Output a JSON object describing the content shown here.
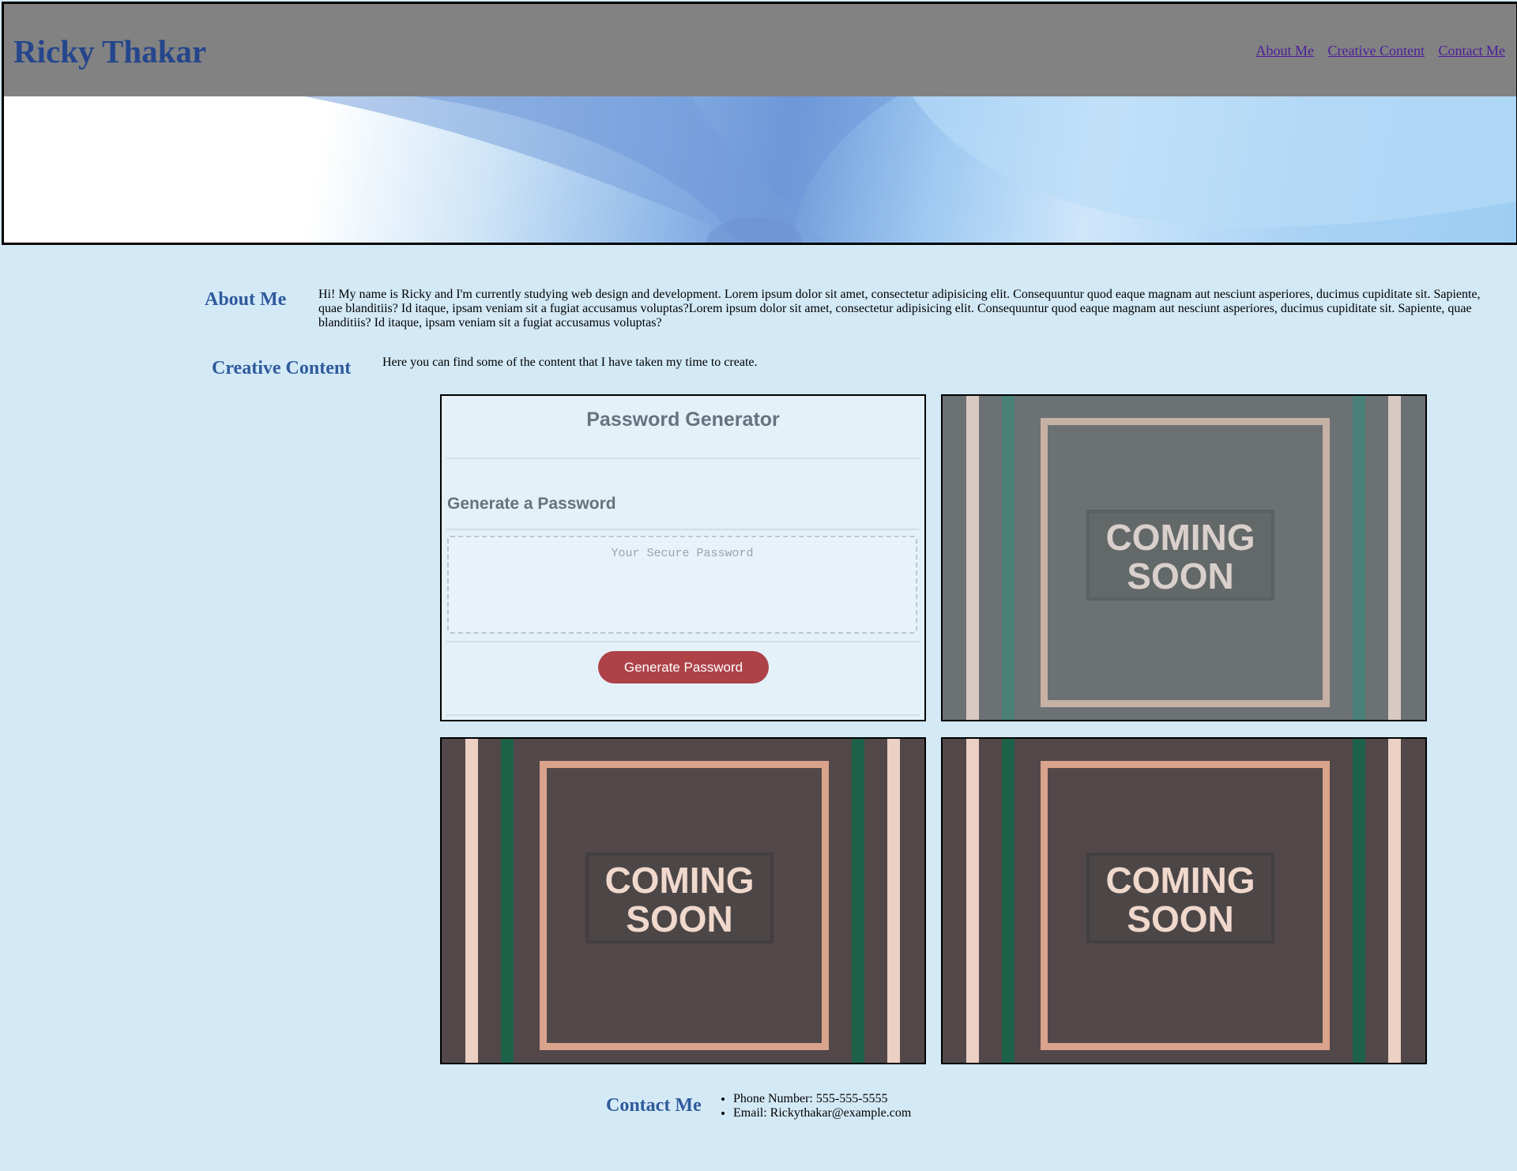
{
  "header": {
    "title": "Ricky Thakar",
    "nav": [
      "About Me",
      "Creative Content",
      "Contact Me"
    ]
  },
  "about": {
    "heading": "About Me",
    "text": "Hi! My name is Ricky and I'm currently studying web design and development. Lorem ipsum dolor sit amet, consectetur adipisicing elit. Consequuntur quod eaque magnam aut nesciunt asperiores, ducimus cupiditate sit. Sapiente, quae blanditiis? Id itaque, ipsam veniam sit a fugiat accusamus voluptas?Lorem ipsum dolor sit amet, consectetur adipisicing elit. Consequuntur quod eaque magnam aut nesciunt asperiores, ducimus cupiditate sit. Sapiente, quae blanditiis? Id itaque, ipsam veniam sit a fugiat accusamus voluptas?"
  },
  "creative": {
    "heading": "Creative Content",
    "intro": "Here you can find some of the content that I have taken my time to create.",
    "password_card": {
      "title": "Password Generator",
      "subtitle": "Generate a Password",
      "placeholder": "Your Secure Password",
      "button": "Generate Password"
    },
    "coming_soon": [
      "COMING",
      "SOON"
    ]
  },
  "contact": {
    "heading": "Contact Me",
    "items": [
      "Phone Number: 555-555-5555",
      "Email: Rickythakar@example.com"
    ]
  },
  "colors": {
    "page_bg": "#d3e9f6",
    "header_bar": "#828282",
    "heading": "#2f5a9c",
    "button": "#ae4249"
  }
}
